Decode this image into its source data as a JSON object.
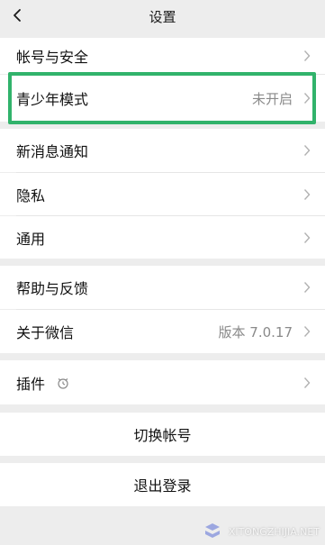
{
  "header": {
    "title": "设置",
    "back_icon": "chevron-left-icon"
  },
  "rows": {
    "account_security": {
      "label": "帐号与安全"
    },
    "youth_mode": {
      "label": "青少年模式",
      "value": "未开启"
    },
    "new_message": {
      "label": "新消息通知"
    },
    "privacy": {
      "label": "隐私"
    },
    "general": {
      "label": "通用"
    },
    "help_feedback": {
      "label": "帮助与反馈"
    },
    "about": {
      "label": "关于微信",
      "value": "版本 7.0.17"
    },
    "plugins": {
      "label": "插件",
      "icon": "plugin-icon"
    },
    "switch_account": {
      "label": "切换帐号"
    },
    "logout": {
      "label": "退出登录"
    }
  },
  "colors": {
    "highlight": "#31b36b",
    "background": "#ededed",
    "row": "#ffffff",
    "secondary_text": "#8a8a8a"
  },
  "watermark": {
    "text": "XITONGZHIJIA.NET"
  }
}
